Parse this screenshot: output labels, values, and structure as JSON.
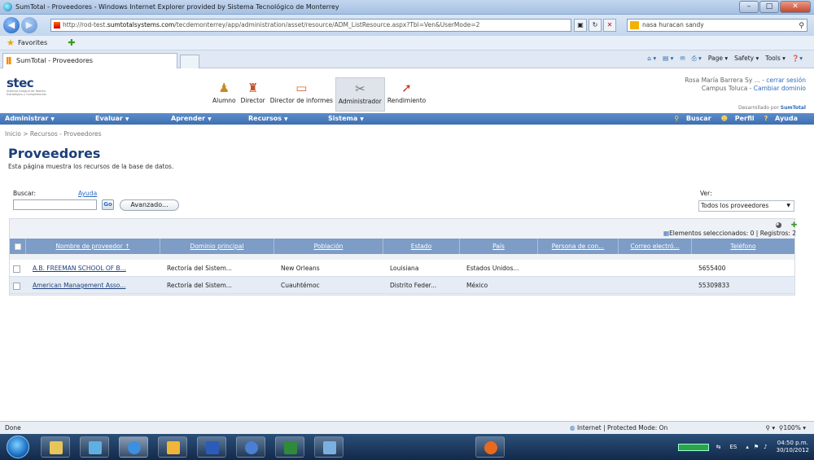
{
  "browser": {
    "window_title": "SumTotal - Proveedores - Windows Internet Explorer provided by Sistema Tecnológico de Monterrey",
    "url_prefix": "http://rod-test.",
    "url_domain": "sumtotalsystems.com",
    "url_path": "/tecdemonterrey/app/administration/asset/resource/ADM_ListResource.aspx?Tbl=Ven&UserMode=2",
    "search_value": "nasa huracan sandy",
    "favorites_label": "Favorites",
    "tab_title": "SumTotal - Proveedores",
    "command_items": [
      "Page ▾",
      "Safety ▾",
      "Tools ▾"
    ],
    "status_done": "Done",
    "status_zone": "Internet | Protected Mode: On",
    "zoom_level": "100%"
  },
  "app": {
    "roles": [
      {
        "label": "Alumno",
        "icon": "student-icon"
      },
      {
        "label": "Director",
        "icon": "manager-icon"
      },
      {
        "label": "Director de informes",
        "icon": "report-icon"
      },
      {
        "label": "Administrador",
        "icon": "admin-tools-icon"
      },
      {
        "label": "Rendimiento",
        "icon": "performance-icon"
      }
    ],
    "user_name": "Rosa María Barrera Sy ...",
    "logout_label": "cerrar sesión",
    "campus": "Campus Toluca",
    "change_domain_label": "Cambiar dominio",
    "powered_prefix": "Desarrollado por",
    "powered_brand": "SumTotal",
    "menu": [
      "Administrar",
      "Evaluar",
      "Aprender",
      "Recursos",
      "Sistema"
    ],
    "menu_right": [
      "Buscar",
      "Perfil",
      "Ayuda"
    ]
  },
  "page": {
    "breadcrumb": "Inicio > Recursos - Proveedores",
    "title": "Proveedores",
    "description": "Esta página muestra los recursos de la base de datos.",
    "search_label": "Buscar:",
    "help_label": "Ayuda",
    "search_value": "",
    "go_label": "Go",
    "advanced_label": "Avanzado...",
    "view_label": "Ver:",
    "view_selected": "Todos los proveedores",
    "selection_info": "Elementos seleccionados: 0 | Registros: 2"
  },
  "grid": {
    "columns": [
      "Nombre de proveedor ↑",
      "Dominio principal",
      "Población",
      "Estado",
      "País",
      "Persona de con...",
      "Correo electró...",
      "Teléfono"
    ],
    "rows": [
      [
        "A.B. FREEMAN SCHOOL OF B...",
        "Rectoría del Sistem...",
        "New Orleans",
        "Louisiana",
        "Estados Unidos...",
        "",
        "",
        "5655400"
      ],
      [
        "American Management Asso...",
        "Rectoría del Sistem...",
        "Cuauhtémoc",
        "Distrito Feder...",
        "México",
        "",
        "",
        "55309833"
      ]
    ]
  },
  "taskbar": {
    "language": "ES",
    "clock_time": "04:50 p.m.",
    "clock_date": "30/10/2012"
  },
  "colors": {
    "menu_bar": "#3f6fae",
    "grid_header": "#7d9cc6",
    "title_blue": "#1b3f7a",
    "link_blue": "#2e6cbf"
  }
}
